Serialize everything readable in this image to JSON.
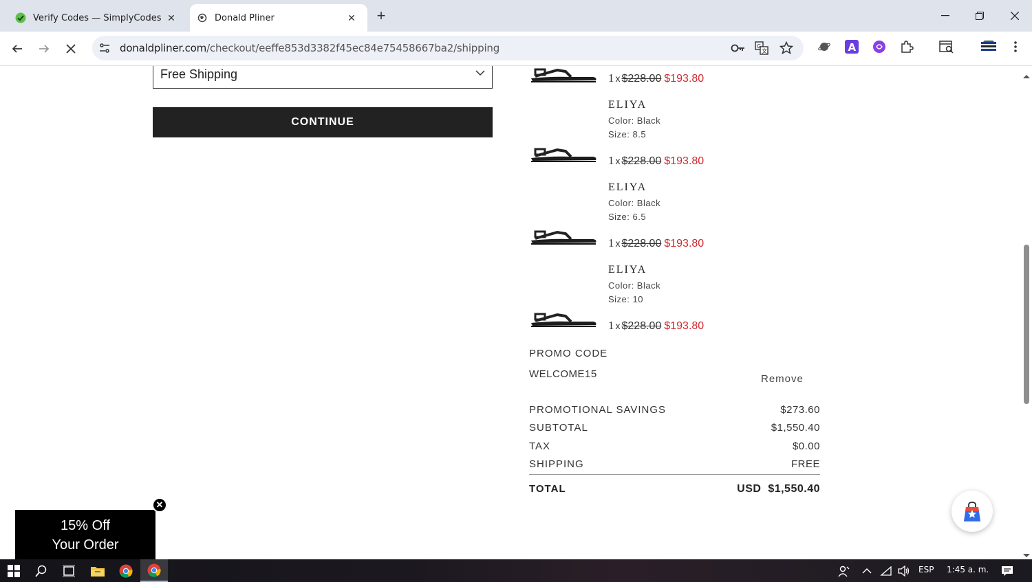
{
  "browser": {
    "tabs": [
      {
        "title": "Verify Codes — SimplyCodes",
        "icon": "simplycodes-icon"
      },
      {
        "title": "Donald Pliner",
        "icon": "loading-globe-icon"
      }
    ],
    "url_host": "donaldpliner.com",
    "url_path": "/checkout/eeffe853d3382f45ec84e75458667ba2/shipping"
  },
  "checkout": {
    "shipping_method": "Free Shipping",
    "continue_label": "CONTINUE"
  },
  "order": {
    "items": [
      {
        "name": "",
        "color": "",
        "size": "",
        "qty": "1",
        "x": "x",
        "orig_price": "$228.00",
        "sale_price": "$193.80"
      },
      {
        "name": "ELIYA",
        "color": "Color: Black",
        "size": "Size: 8.5",
        "qty": "1",
        "x": "x",
        "orig_price": "$228.00",
        "sale_price": "$193.80"
      },
      {
        "name": "ELIYA",
        "color": "Color: Black",
        "size": "Size: 6.5",
        "qty": "1",
        "x": "x",
        "orig_price": "$228.00",
        "sale_price": "$193.80"
      },
      {
        "name": "ELIYA",
        "color": "Color: Black",
        "size": "Size: 10",
        "qty": "1",
        "x": "x",
        "orig_price": "$228.00",
        "sale_price": "$193.80"
      }
    ],
    "promo_label": "PROMO CODE",
    "promo_code": "WELCOME15",
    "remove_label": "Remove",
    "summary": {
      "savings_label": "PROMOTIONAL SAVINGS",
      "savings": "$273.60",
      "subtotal_label": "SUBTOTAL",
      "subtotal": "$1,550.40",
      "tax_label": "TAX",
      "tax": "$0.00",
      "shipping_label": "SHIPPING",
      "shipping": "FREE",
      "total_label": "TOTAL",
      "total_currency": "USD",
      "total": "$1,550.40"
    }
  },
  "popup": {
    "line1": "15% Off",
    "line2": "Your Order"
  },
  "taskbar": {
    "lang": "ESP",
    "time": "1:45 a. m."
  },
  "colors": {
    "sale": "#d0292f",
    "button": "#222222",
    "tabstrip": "#dfe3eb"
  }
}
